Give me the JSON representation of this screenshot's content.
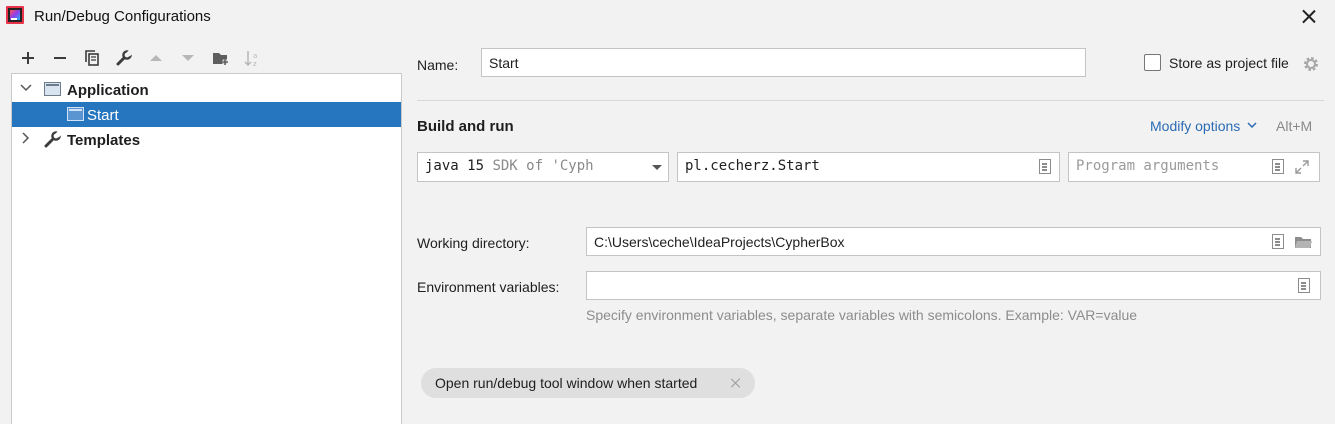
{
  "window": {
    "title": "Run/Debug Configurations"
  },
  "toolbar": {
    "icons": [
      "add-icon",
      "remove-icon",
      "copy-icon",
      "wrench-icon",
      "move-up-icon",
      "move-down-icon",
      "new-folder-icon",
      "sort-alphabetically-icon"
    ]
  },
  "tree": {
    "items": [
      {
        "label": "Application",
        "expanded": true
      },
      {
        "label": "Start",
        "selected": true
      },
      {
        "label": "Templates",
        "expanded": false
      }
    ]
  },
  "form": {
    "name_label": "Name:",
    "name_value": "Start",
    "store_label": "Store as project file",
    "section_title": "Build and run",
    "modify_options": "Modify options",
    "modify_shortcut": "Alt+M",
    "sdk_main": "java 15",
    "sdk_detail": "SDK of 'Cyph",
    "main_class": "pl.cecherz.Start",
    "program_args_placeholder": "Program arguments",
    "working_dir_label": "Working directory:",
    "working_dir_value": "C:\\Users\\ceche\\IdeaProjects\\CypherBox",
    "env_label": "Environment variables:",
    "env_value": "",
    "env_hint": "Specify environment variables, separate variables with semicolons. Example: VAR=value",
    "chip_label": "Open run/debug tool window when started"
  },
  "colors": {
    "selection": "#2675bf",
    "link": "#2a6bb5",
    "hint": "#8c8c8c"
  }
}
